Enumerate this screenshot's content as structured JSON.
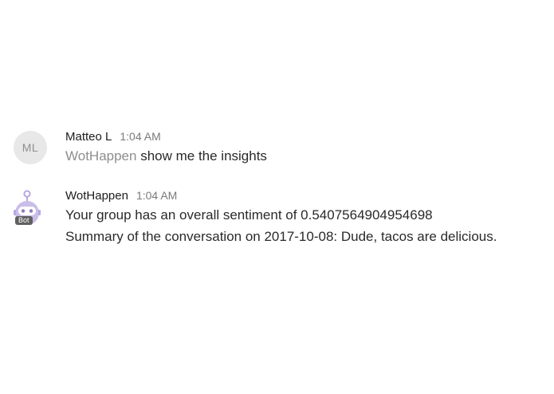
{
  "messages": [
    {
      "sender": "Matteo L",
      "time": "1:04 AM",
      "avatar_initials": "ML",
      "mention": "WotHappen",
      "text": " show me the insights"
    },
    {
      "sender": "WotHappen",
      "time": "1:04 AM",
      "avatar_badge": "Bot",
      "avatar_icon": "robot-icon",
      "lines": [
        "Your group has an overall sentiment of 0.5407564904954698",
        "Summary of the conversation on 2017-10-08: Dude, tacos are delicious."
      ]
    }
  ],
  "colors": {
    "avatar_bg": "#e8e8e8",
    "mention": "#8e8e8e",
    "bot_purple": "#b7a8de",
    "badge_bg": "#616061"
  }
}
